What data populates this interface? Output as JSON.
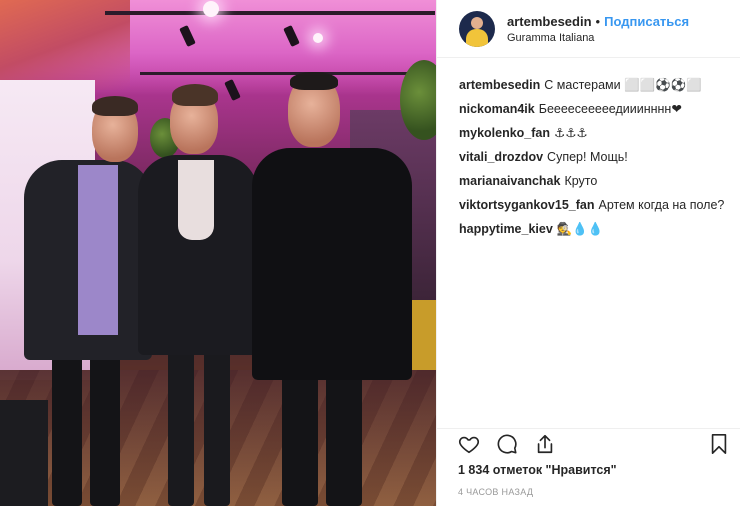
{
  "post": {
    "author": "artembesedin",
    "separator": "•",
    "follow_label": "Подписаться",
    "location": "Guramma Italiana"
  },
  "comments": [
    {
      "user": "artembesedin",
      "text": "С мастерами ⬜⬜⚽⚽⬜"
    },
    {
      "user": "nickoman4ik",
      "text": "Беееесееееедииинннн❤"
    },
    {
      "user": "mykolenko_fan",
      "text": "⚓⚓⚓"
    },
    {
      "user": "vitali_drozdov",
      "text": "Супер! Мощь!"
    },
    {
      "user": "marianaivanchak",
      "text": "Круто"
    },
    {
      "user": "viktortsygankov15_fan",
      "text": "Артем когда на поле?"
    },
    {
      "user": "happytime_kiev",
      "text": "🕵💧💧"
    }
  ],
  "likes_text": "1 834 отметок \"Нравится\"",
  "time_ago": "4 ЧАСОВ НАЗАД",
  "icons": {
    "like": "heart-icon",
    "comment": "comment-bubble-icon",
    "share": "share-icon",
    "save": "bookmark-icon"
  },
  "colors": {
    "follow": "#3897f0",
    "text": "#262626",
    "muted": "#999999",
    "border": "#efefef"
  }
}
